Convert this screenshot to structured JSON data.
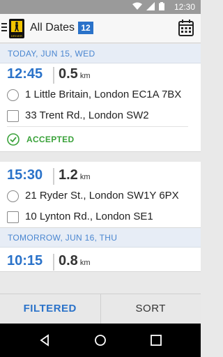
{
  "status_bar": {
    "time": "12:30"
  },
  "app_bar": {
    "title": "All Dates",
    "badge": "12",
    "logo_text": "DRIVER"
  },
  "sections": [
    {
      "header": "TODAY, JUN 15, WED"
    },
    {
      "header": "TOMORROW, JUN 16, THU"
    }
  ],
  "jobs": [
    {
      "time": "12:45",
      "distance": "0.5",
      "unit": "km",
      "pickup": "1 Little Britain, London EC1A 7BX",
      "dropoff": "33 Trent Rd., London SW2",
      "status": "ACCEPTED"
    },
    {
      "time": "15:30",
      "distance": "1.2",
      "unit": "km",
      "pickup": "21 Ryder St., London SW1Y 6PX",
      "dropoff": "10 Lynton Rd., London SE1"
    },
    {
      "time": "10:15",
      "distance": "0.8",
      "unit": "km"
    }
  ],
  "bottom_bar": {
    "filtered": "FILTERED",
    "sort": "SORT"
  },
  "colors": {
    "accent": "#2a72c9",
    "accepted": "#3aa23a",
    "section_text": "#4a86d0"
  }
}
